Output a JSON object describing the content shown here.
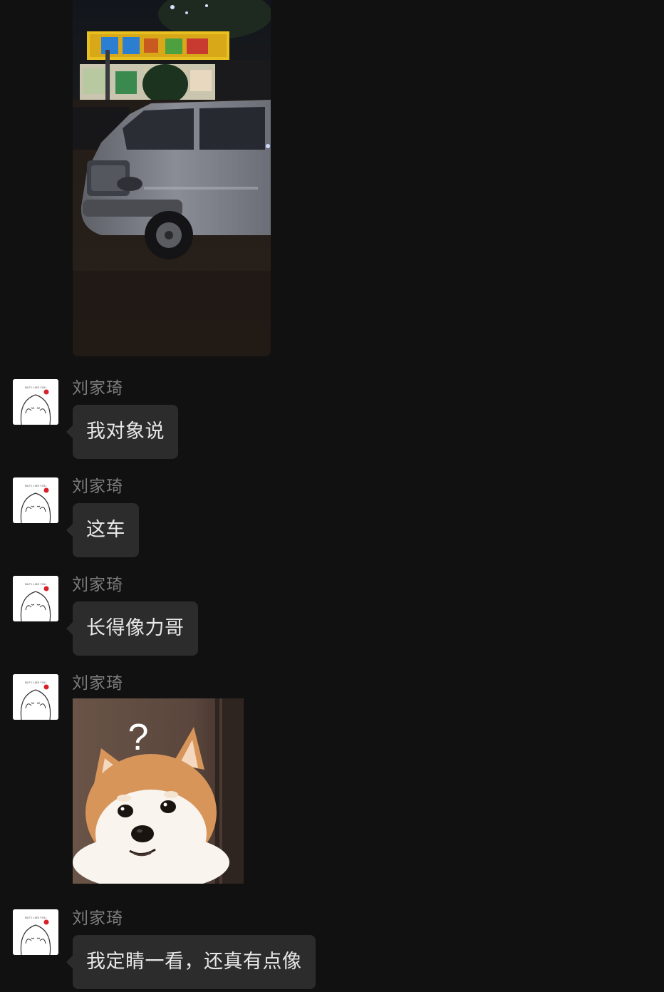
{
  "colors": {
    "background": "#111111",
    "bubble": "#2c2c2c",
    "bubble_text": "#e8e8e8",
    "sender_text": "#7d7d7d"
  },
  "photo": {
    "icon": "car-night-photo"
  },
  "messages": [
    {
      "sender": "刘家琦",
      "text": "我对象说",
      "type": "text"
    },
    {
      "sender": "刘家琦",
      "text": "这车",
      "type": "text"
    },
    {
      "sender": "刘家琦",
      "text": "长得像力哥",
      "type": "text"
    },
    {
      "sender": "刘家琦",
      "type": "sticker",
      "sticker": "shiba-question-icon",
      "sticker_text": "?"
    },
    {
      "sender": "刘家琦",
      "text": "我定睛一看，还真有点像",
      "type": "text"
    }
  ]
}
